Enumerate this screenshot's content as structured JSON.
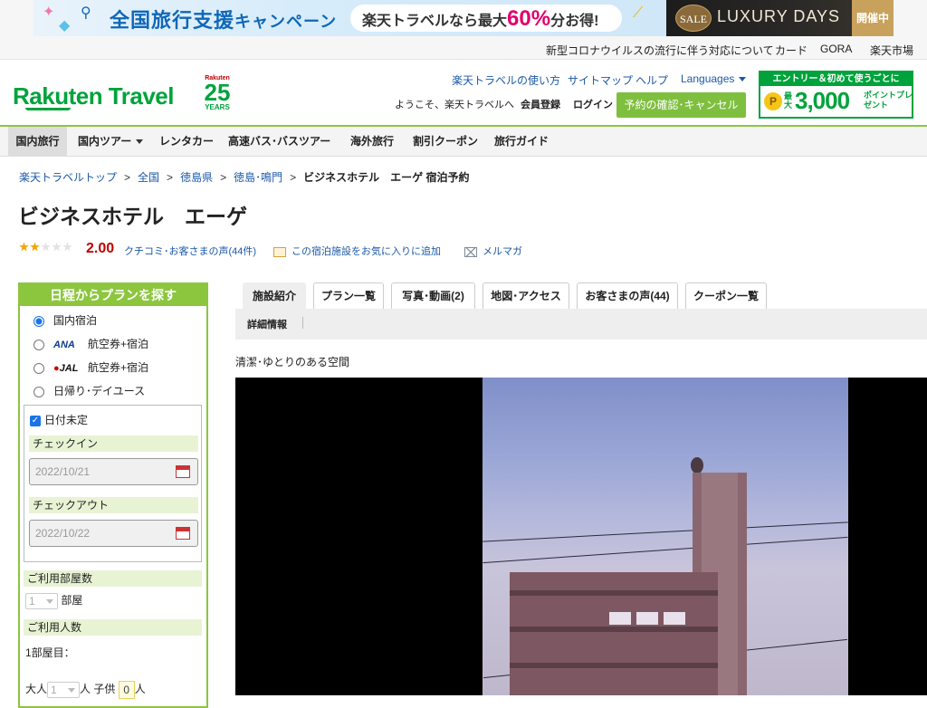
{
  "banner": {
    "campaign_title": "全国旅行支援",
    "campaign_suffix": "キャンペーン",
    "promo_prefix": "楽天トラベルなら最大",
    "promo_highlight": "60%",
    "promo_suffix": "分お得!",
    "luxury_sale": "SALE",
    "luxury_title": "LUXURY DAYS",
    "luxury_status": "開催中"
  },
  "topnav": {
    "items": [
      "新型コロナウイルスの流行に伴う対応について",
      "カード",
      "GORA",
      "楽天市場"
    ]
  },
  "header": {
    "logo_text": "Rakuten Travel",
    "anniv_brand": "Rakuten",
    "anniv_number": "25",
    "anniv_years": "YEARS",
    "help_links": [
      "楽天トラベルの使い方",
      "サイトマップ",
      "ヘルプ"
    ],
    "languages": "Languages",
    "welcome": "ようこそ、楽天トラベルへ",
    "member_register": "会員登録",
    "login": "ログイン",
    "reservation_button": "予約の確認･キャンセル",
    "promo_top": "エントリー＆初めて使うごとに",
    "promo_coin": "P",
    "promo_max": "最大",
    "promo_amount": "3,000",
    "promo_points": "ポイントプレゼント"
  },
  "globalnav": {
    "items": [
      "国内旅行",
      "国内ツアー",
      "レンタカー",
      "高速バス･バスツアー",
      "海外旅行",
      "割引クーポン",
      "旅行ガイド"
    ],
    "active_index": 0
  },
  "breadcrumb": {
    "items": [
      "楽天トラベルトップ",
      "全国",
      "徳島県",
      "徳島･鳴門"
    ],
    "separator": ">",
    "current": "ビジネスホテル　エーゲ 宿泊予約"
  },
  "hotel": {
    "name": "ビジネスホテル　エーゲ",
    "rating": 2.0,
    "rating_text": "2.00",
    "stars_total": 5,
    "review_link": "クチコミ･お客さまの声(44件)",
    "favorite_link": "この宿泊施設をお気に入りに追加",
    "mailmag_link": "メルマガ"
  },
  "search_panel": {
    "title": "日程からプランを探す",
    "options": [
      {
        "label": "国内宿泊",
        "logo": ""
      },
      {
        "label": "航空券+宿泊",
        "logo": "ANA"
      },
      {
        "label": "航空券+宿泊",
        "logo": "JAL"
      },
      {
        "label": "日帰り･デイユース",
        "logo": ""
      }
    ],
    "selected_option": 0,
    "date_undecided_label": "日付未定",
    "date_undecided_checked": true,
    "checkin_label": "チェックイン",
    "checkin_value": "2022/10/21",
    "checkout_label": "チェックアウト",
    "checkout_value": "2022/10/22",
    "rooms_label": "ご利用部屋数",
    "rooms_value": "1",
    "rooms_unit": "部屋",
    "guests_label": "ご利用人数",
    "room1_label": "1部屋目：",
    "adult_label": "大人",
    "adult_value": "1",
    "person_unit": "人",
    "child_label": "子供",
    "child_value": "0"
  },
  "tabs": {
    "items": [
      "施設紹介",
      "プラン一覧",
      "写真･動画(2)",
      "地図･アクセス",
      "お客さまの声(44)",
      "クーポン一覧"
    ],
    "active_index": 0,
    "sub_items": [
      "詳細情報"
    ]
  },
  "content": {
    "caption": "清潔･ゆとりのある空間"
  },
  "colors": {
    "brand_green": "#00a33b",
    "nav_green": "#8cc63f",
    "link_blue": "#1b58a8",
    "price_red": "#bf0000"
  }
}
